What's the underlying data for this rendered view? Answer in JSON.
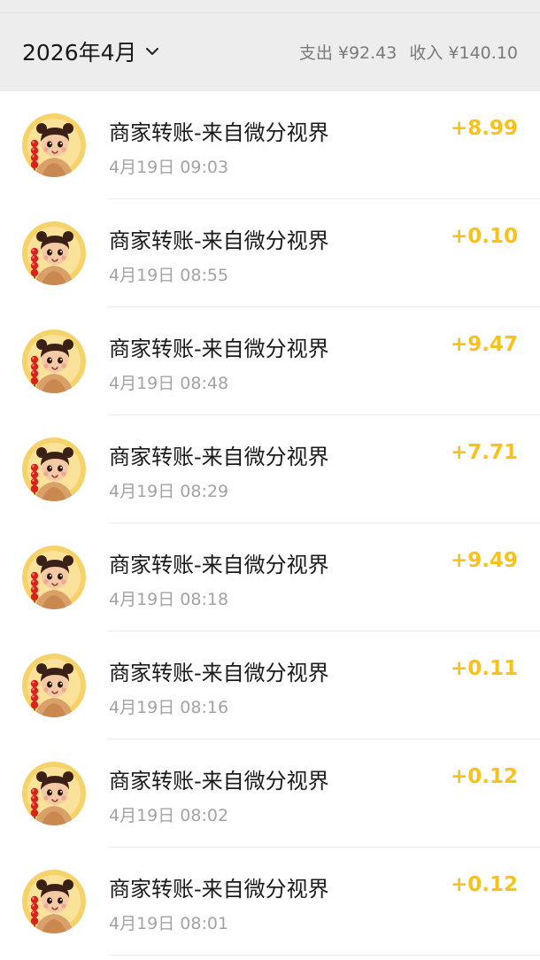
{
  "header": {
    "month_label": "2026年4月",
    "expense_label": "支出",
    "expense_amount": "¥92.43",
    "income_label": "收入",
    "income_amount": "¥140.10"
  },
  "colors": {
    "income_accent": "#f7c31b",
    "header_bg": "#ededed"
  },
  "transactions": [
    {
      "title": "商家转账-来自微分视界",
      "time": "4月19日 09:03",
      "amount": "+8.99",
      "icon": "avatar-girl-icon"
    },
    {
      "title": "商家转账-来自微分视界",
      "time": "4月19日 08:55",
      "amount": "+0.10",
      "icon": "avatar-girl-icon"
    },
    {
      "title": "商家转账-来自微分视界",
      "time": "4月19日 08:48",
      "amount": "+9.47",
      "icon": "avatar-girl-icon"
    },
    {
      "title": "商家转账-来自微分视界",
      "time": "4月19日 08:29",
      "amount": "+7.71",
      "icon": "avatar-girl-icon"
    },
    {
      "title": "商家转账-来自微分视界",
      "time": "4月19日 08:18",
      "amount": "+9.49",
      "icon": "avatar-girl-icon"
    },
    {
      "title": "商家转账-来自微分视界",
      "time": "4月19日 08:16",
      "amount": "+0.11",
      "icon": "avatar-girl-icon"
    },
    {
      "title": "商家转账-来自微分视界",
      "time": "4月19日 08:02",
      "amount": "+0.12",
      "icon": "avatar-girl-icon"
    },
    {
      "title": "商家转账-来自微分视界",
      "time": "4月19日 08:01",
      "amount": "+0.12",
      "icon": "avatar-girl-icon"
    }
  ]
}
